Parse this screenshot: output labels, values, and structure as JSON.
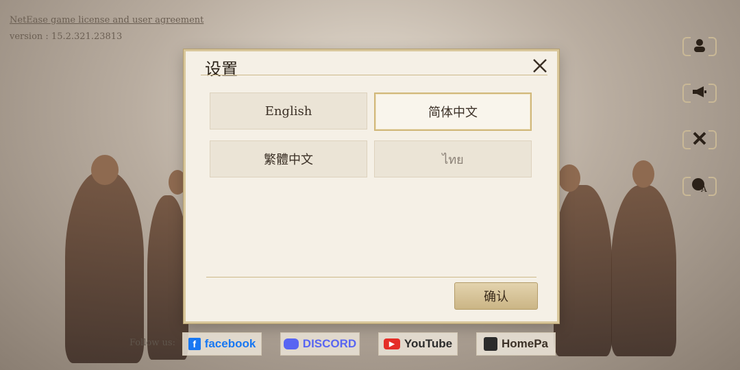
{
  "top_left": {
    "agreement": "NetEase game license and user agreement",
    "version": "version : 15.2.321.23813"
  },
  "side_icons": [
    "user-icon",
    "megaphone-icon",
    "tools-icon",
    "language-globe-icon"
  ],
  "dialog": {
    "title": "设置",
    "close_icon": "close-icon",
    "languages": [
      {
        "label": "English",
        "selected": false
      },
      {
        "label": "简体中文",
        "selected": true
      },
      {
        "label": "繁體中文",
        "selected": false
      },
      {
        "label": "ไทย",
        "selected": false
      }
    ],
    "confirm_label": "确认"
  },
  "footer": {
    "follow_label": "Follow us:",
    "links": [
      {
        "label": "facebook",
        "icon": "facebook-icon",
        "color": "#1877f2"
      },
      {
        "label": "DISCORD",
        "icon": "discord-icon",
        "color": "#5865f2"
      },
      {
        "label": "YouTube",
        "icon": "youtube-icon",
        "color": "#e52d27"
      },
      {
        "label": "HomePa",
        "icon": "homepage-icon",
        "color": "#2b2b2b"
      }
    ]
  }
}
